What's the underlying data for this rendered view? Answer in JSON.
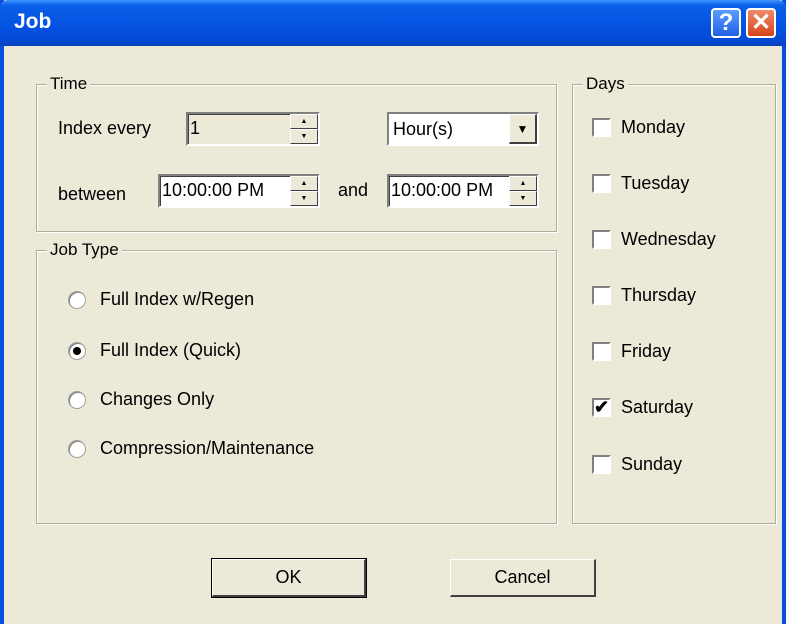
{
  "window": {
    "title": "Job",
    "help_glyph": "?",
    "close_glyph": "✕"
  },
  "time": {
    "legend": "Time",
    "index_every_label": "Index every",
    "index_every_value": "1",
    "unit_selected": "Hour(s)",
    "between_label": "between",
    "start_time": "10:00:00 PM",
    "and_label": "and",
    "end_time": "10:00:00 PM"
  },
  "job_type": {
    "legend": "Job Type",
    "options": [
      {
        "label": "Full Index w/Regen",
        "checked": false
      },
      {
        "label": "Full Index (Quick)",
        "checked": true
      },
      {
        "label": "Changes Only",
        "checked": false
      },
      {
        "label": "Compression/Maintenance",
        "checked": false
      }
    ]
  },
  "days": {
    "legend": "Days",
    "items": [
      {
        "label": "Monday",
        "checked": false
      },
      {
        "label": "Tuesday",
        "checked": false
      },
      {
        "label": "Wednesday",
        "checked": false
      },
      {
        "label": "Thursday",
        "checked": false
      },
      {
        "label": "Friday",
        "checked": false
      },
      {
        "label": "Saturday",
        "checked": true
      },
      {
        "label": "Sunday",
        "checked": false
      }
    ]
  },
  "buttons": {
    "ok": "OK",
    "cancel": "Cancel"
  },
  "glyphs": {
    "dropdown": "▼",
    "spin_up": "▲",
    "spin_down": "▼",
    "check": "✔"
  },
  "colors": {
    "title_bar": "#0554e3",
    "face": "#ece9d8",
    "close": "#d6451c"
  }
}
